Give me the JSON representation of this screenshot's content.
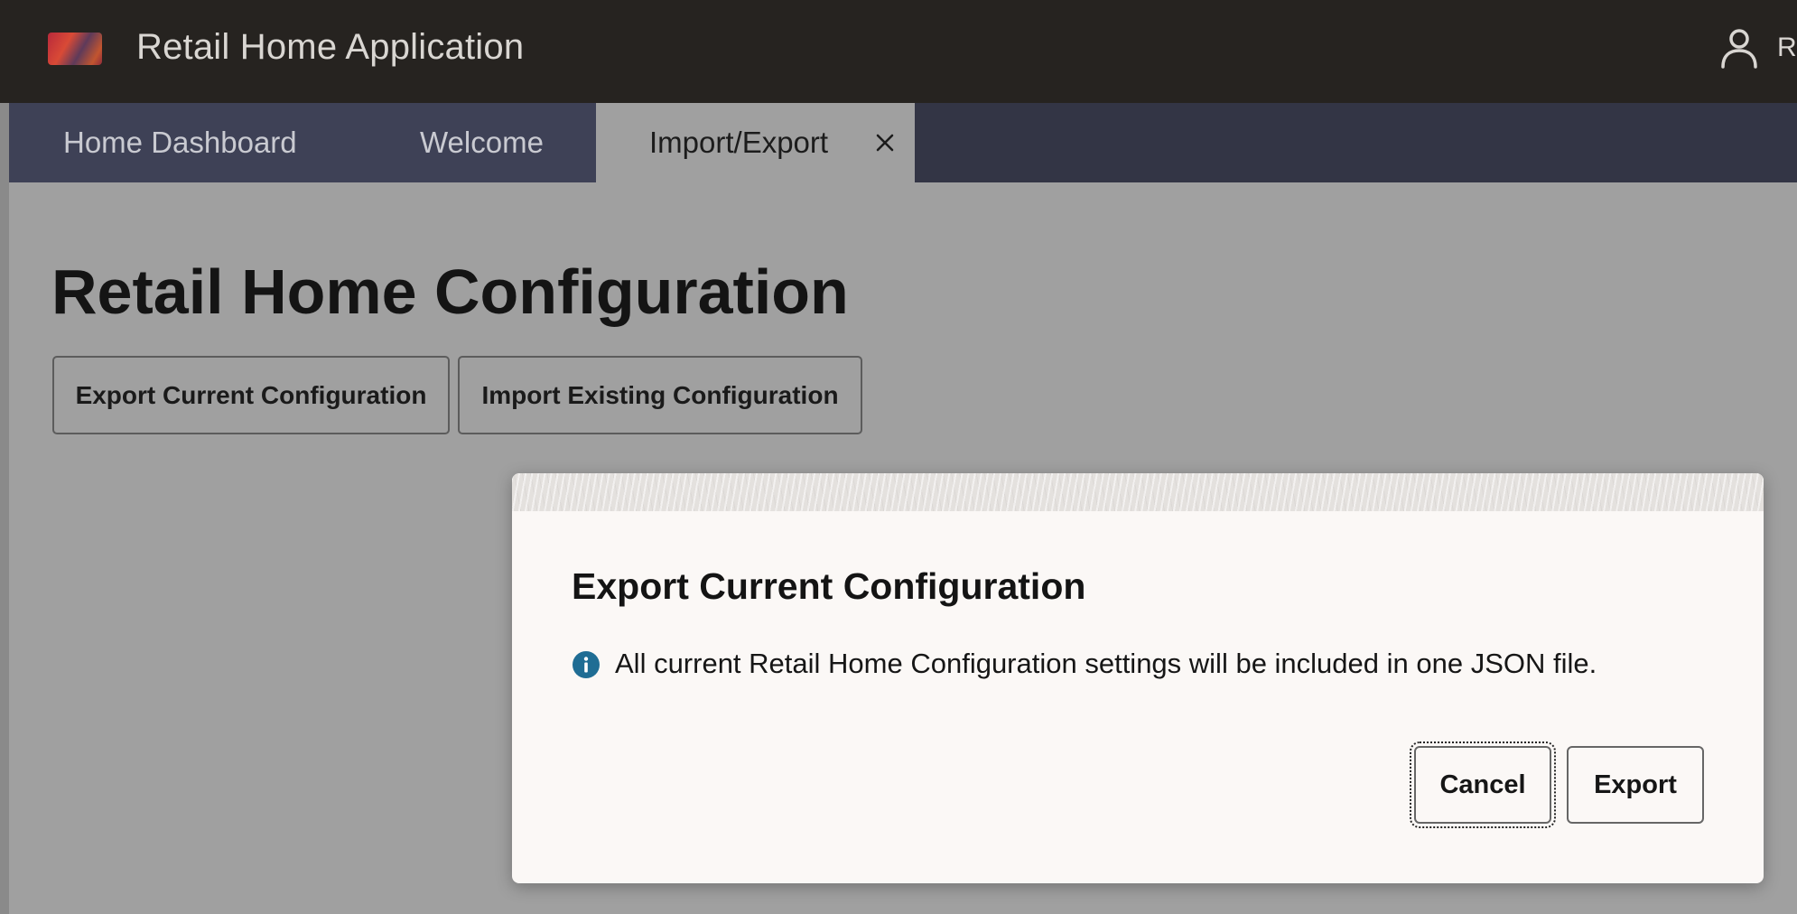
{
  "header": {
    "app_title": "Retail Home Application",
    "logo_icon": "oracle-retail-logo",
    "user_icon": "person-icon",
    "user_name_partial": "Ro"
  },
  "tabs": [
    {
      "label": "Home Dashboard",
      "active": false
    },
    {
      "label": "Welcome",
      "active": false
    },
    {
      "label": "Import/Export",
      "active": true,
      "closable": true
    }
  ],
  "page": {
    "title": "Retail Home Configuration",
    "buttons": {
      "export_label": "Export Current Configuration",
      "import_label": "Import Existing Configuration"
    }
  },
  "dialog": {
    "title": "Export Current Configuration",
    "info_icon": "info-circle-icon",
    "message": "All current Retail Home Configuration settings will be included in one JSON file.",
    "cancel_label": "Cancel",
    "export_label": "Export"
  },
  "colors": {
    "header_bg": "#262320",
    "tabbar_bg": "#333545",
    "overlay_bg": "#a0a0a0",
    "dialog_bg": "#fbf8f6",
    "info_accent": "#1f6d94"
  }
}
